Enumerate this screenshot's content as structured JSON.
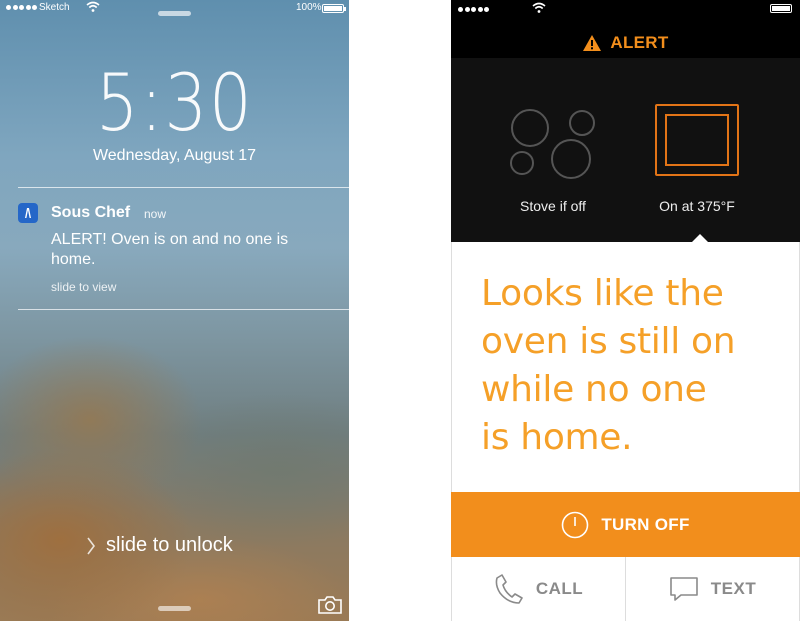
{
  "lock_screen": {
    "status": {
      "carrier": "Sketch",
      "battery": "100%"
    },
    "time": "5:30",
    "date": "Wednesday, August 17",
    "notification": {
      "app_name": "Sous Chef",
      "when": "now",
      "message": "ALERT! Oven is on and no one is home.",
      "hint": "slide to view"
    },
    "unlock_text": "slide to unlock"
  },
  "app_screen": {
    "header_title": "ALERT",
    "stove_label": "Stove if off",
    "oven_label": "On at 375°F",
    "message_lines": [
      "Looks like the",
      "oven is still on",
      "while no one",
      "is home."
    ],
    "turn_off_label": "TURN OFF",
    "call_label": "CALL",
    "text_label": "TEXT"
  },
  "colors": {
    "accent": "#f28e1c",
    "message_text": "#f5a028",
    "oven_outline": "#e27417",
    "panel_bg": "#111111",
    "app_icon": "#2567c8"
  },
  "icons": {
    "status": [
      "signal-dots-icon",
      "wifi-icon",
      "battery-icon"
    ],
    "notification": "sous-chef-app-icon",
    "lock_bottom": [
      "chevron-right-icon",
      "camera-icon"
    ],
    "header": "warning-icon",
    "appliances": [
      "stove-burners-icon",
      "oven-icon"
    ],
    "actions": [
      "power-icon",
      "phone-icon",
      "chat-bubble-icon"
    ]
  }
}
